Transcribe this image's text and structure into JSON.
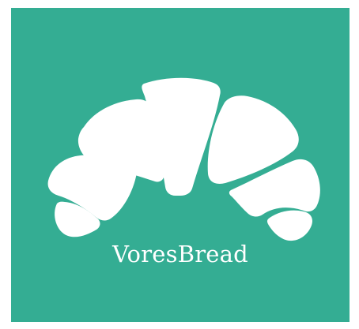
{
  "logo": {
    "brand_name": "VoresBread",
    "icon": "croissant-icon",
    "background_color": "#34AD93",
    "foreground_color": "#FFFFFF"
  }
}
